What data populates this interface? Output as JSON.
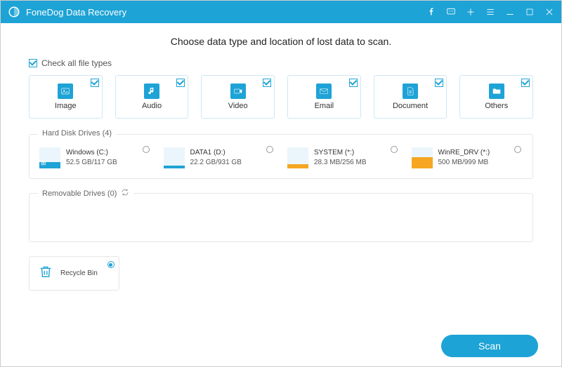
{
  "app_title": "FoneDog Data Recovery",
  "heading": "Choose data type and location of lost data to scan.",
  "check_all_label": "Check all file types",
  "file_types": [
    {
      "name": "Image",
      "icon": "image-icon"
    },
    {
      "name": "Audio",
      "icon": "audio-icon"
    },
    {
      "name": "Video",
      "icon": "video-icon"
    },
    {
      "name": "Email",
      "icon": "email-icon"
    },
    {
      "name": "Document",
      "icon": "document-icon"
    },
    {
      "name": "Others",
      "icon": "folder-icon"
    }
  ],
  "hard_drives": {
    "title": "Hard Disk Drives (4)",
    "items": [
      {
        "name": "Windows (C:)",
        "usage": "52.5 GB/117 GB",
        "color": "#1ea3d6",
        "glyph": "⊞"
      },
      {
        "name": "DATA1 (D:)",
        "usage": "22.2 GB/931 GB",
        "color": "#1ea3d6",
        "glyph": ""
      },
      {
        "name": "SYSTEM (*:)",
        "usage": "28.3 MB/256 MB",
        "color": "#f5a623",
        "glyph": ""
      },
      {
        "name": "WinRE_DRV (*:)",
        "usage": "500 MB/999 MB",
        "color": "#f5a623",
        "glyph": ""
      }
    ]
  },
  "removable": {
    "title": "Removable Drives (0)"
  },
  "recycle_label": "Recycle Bin",
  "scan_label": "Scan"
}
